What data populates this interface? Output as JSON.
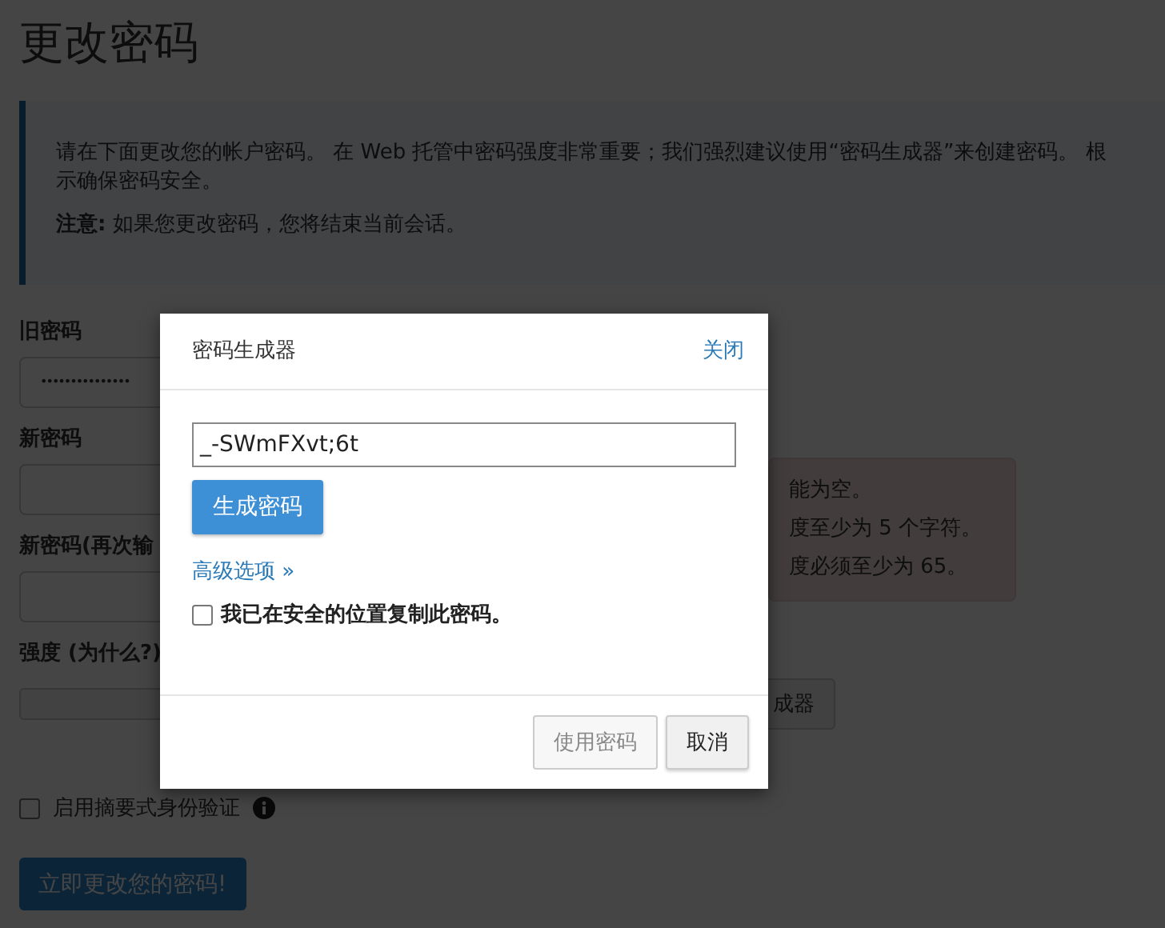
{
  "page": {
    "title": "更改密码",
    "notice": {
      "line_1": "请在下面更改您的帐户密码。 在 Web 托管中密码强度非常重要；我们强烈建议使用“密码生成器”来创建密码。 根",
      "line_2": "示确保密码安全。",
      "note": "**注意:** 如果您更改密码，您将结束当前会话。"
    },
    "fields": [
      {
        "label": "旧密码",
        "value": "•••••••••••••••"
      },
      {
        "label": "新密码"
      },
      {
        "label": "新密码(再次输"
      }
    ],
    "errors": [
      "能为空。",
      "度至少为 5 个字符。",
      "度必须至少为 65。"
    ],
    "strength": {
      "label": "强度 (为什么?)",
      "generator_button": "成器"
    },
    "digest_auth": {
      "label": "启用摘要式身份验证",
      "checked": false
    },
    "submit": "立即更改您的密码!"
  },
  "modal": {
    "title": "密码生成器",
    "close": "关闭",
    "password": "_-SWmFXvt;6t",
    "generate": "生成密码",
    "advanced": "高级选项 »",
    "confirm": {
      "label": "我已在安全的位置复制此密码。",
      "checked": false
    },
    "buttons": [
      {
        "label": "使用密码",
        "disabled": true
      },
      {
        "label": "取消",
        "disabled": false
      }
    ]
  }
}
